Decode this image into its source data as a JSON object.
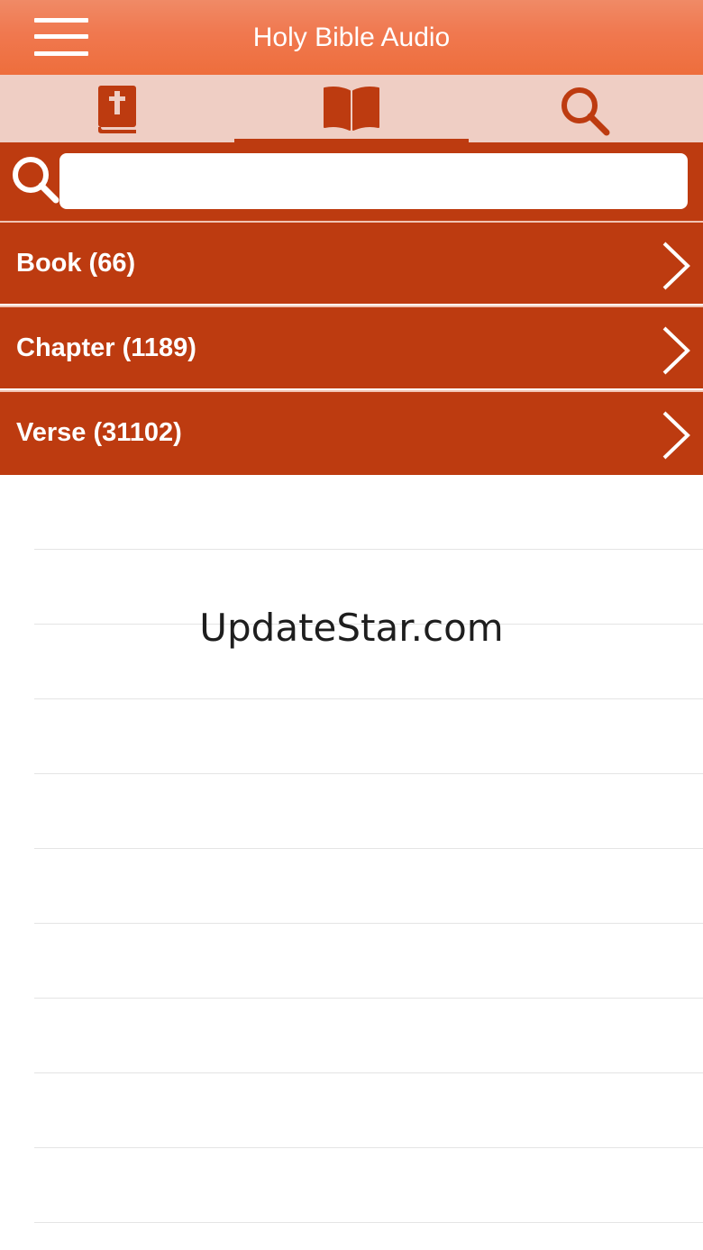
{
  "header": {
    "title": "Holy Bible Audio",
    "menu_icon": "hamburger-menu-icon"
  },
  "tabs": [
    {
      "icon": "bible-book-icon",
      "active": false
    },
    {
      "icon": "open-book-icon",
      "active": false
    },
    {
      "icon": "search-icon",
      "active": true
    }
  ],
  "search": {
    "icon": "search-icon",
    "value": "",
    "placeholder": ""
  },
  "list": [
    {
      "label": "Book (66)"
    },
    {
      "label": "Chapter (1189)"
    },
    {
      "label": "Verse (31102)"
    }
  ],
  "watermark": "UpdateStar.com",
  "colors": {
    "primary": "#bd3b10",
    "header_gradient": "#f0784f",
    "tabbar_bg": "#efcec4"
  }
}
